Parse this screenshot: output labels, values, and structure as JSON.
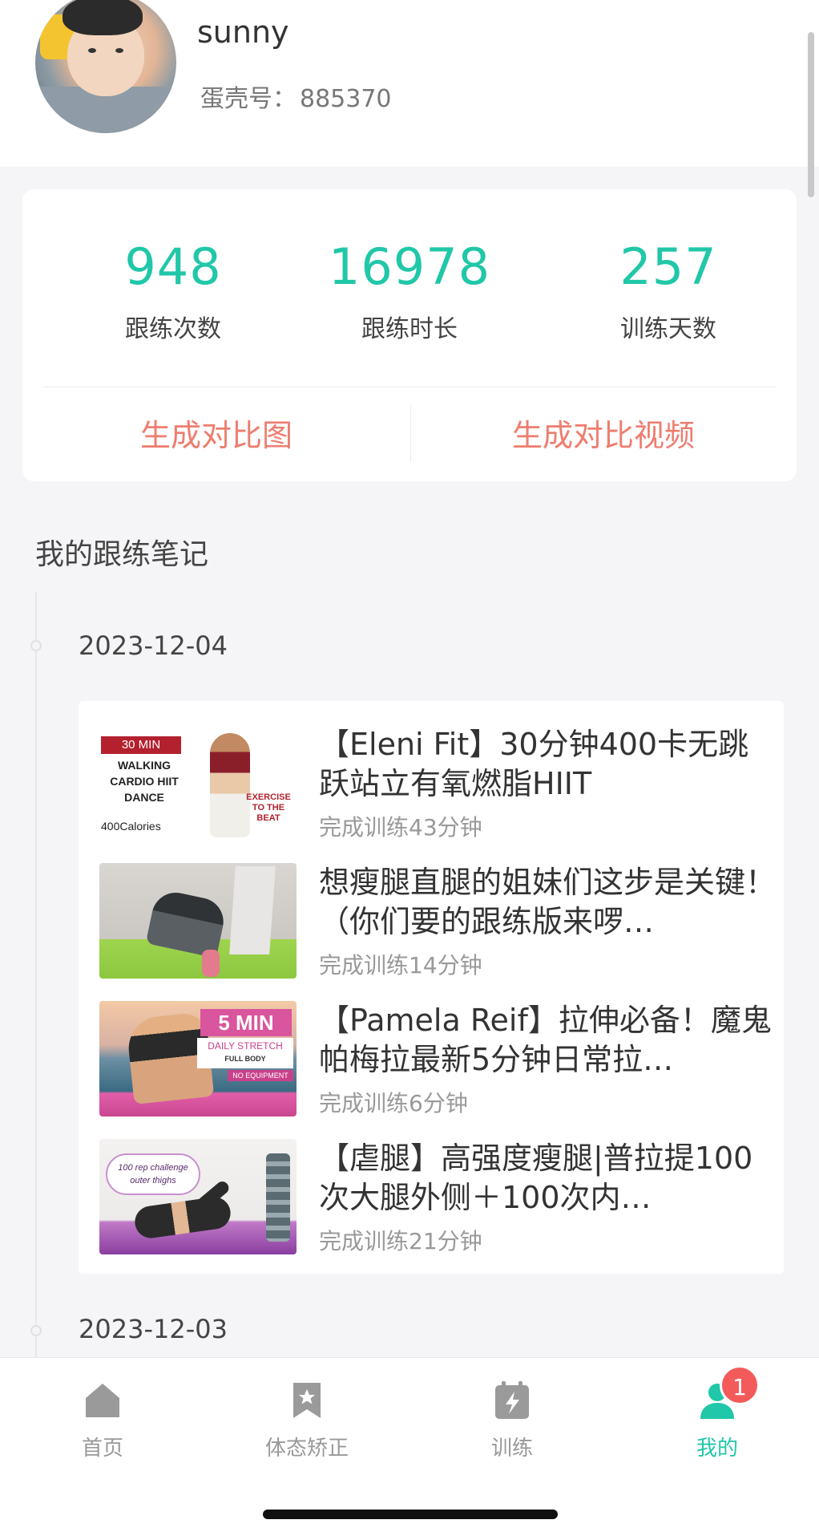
{
  "profile": {
    "name": "sunny",
    "id_label": "蛋壳号：",
    "id_value": "885370"
  },
  "stats": [
    {
      "value": "948",
      "label": "跟练次数"
    },
    {
      "value": "16978",
      "label": "跟练时长"
    },
    {
      "value": "257",
      "label": "训练天数"
    }
  ],
  "actions": {
    "compare_image": "生成对比图",
    "compare_video": "生成对比视频"
  },
  "notes": {
    "section_title": "我的跟练笔记",
    "days": [
      {
        "date": "2023-12-04",
        "items": [
          {
            "title": "【Eleni Fit】30分钟400卡无跳跃站立有氧燃脂HIIT",
            "meta": "完成训练43分钟",
            "thumb": {
              "banner": "30 MIN",
              "text": "WALKING CARDIO HIIT DANCE",
              "footer": "400Calories",
              "side": "EXERCISE TO THE BEAT"
            }
          },
          {
            "title": "想瘦腿直腿的姐妹们这步是关键！（你们要的跟练版来啰…",
            "meta": "完成训练14分钟",
            "thumb": {}
          },
          {
            "title": "【Pamela Reif】拉伸必备！魔鬼帕梅拉最新5分钟日常拉…",
            "meta": "完成训练6分钟",
            "thumb": {
              "banner": "5 MIN",
              "text": "DAILY STRETCH",
              "sub": "FULL BODY",
              "footer": "NO EQUIPMENT"
            }
          },
          {
            "title": "【虐腿】高强度瘦腿|普拉提100次大腿外侧＋100次内…",
            "meta": "完成训练21分钟",
            "thumb": {
              "text": "100 rep challenge",
              "sub": "outer thighs"
            }
          }
        ]
      },
      {
        "date": "2023-12-03"
      }
    ]
  },
  "tabbar": {
    "tabs": [
      {
        "label": "首页",
        "icon": "home-icon"
      },
      {
        "label": "体态矫正",
        "icon": "bookmark-star-icon"
      },
      {
        "label": "训练",
        "icon": "lightning-calendar-icon"
      },
      {
        "label": "我的",
        "icon": "person-icon"
      }
    ],
    "active_index": 3,
    "badge": "1"
  },
  "colors": {
    "accent": "#20c7a8",
    "action_text": "#ee7d6f",
    "badge": "#f35a5a"
  }
}
